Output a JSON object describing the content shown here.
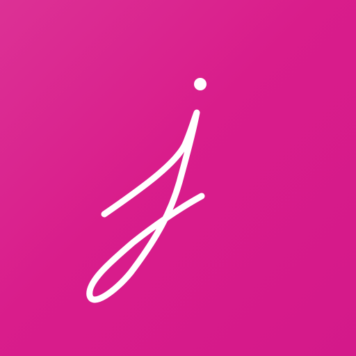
{
  "app": {
    "logo_icon": "script-j-logo-icon",
    "background_color": "#d81e8a",
    "logo_color": "#ffffff"
  }
}
